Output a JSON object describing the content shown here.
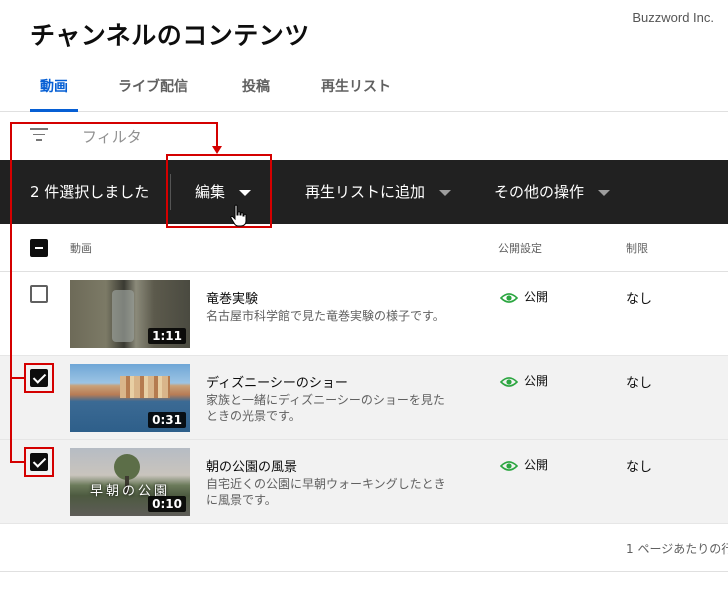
{
  "watermark": "Buzzword Inc.",
  "page_title": "チャンネルのコンテンツ",
  "tabs": [
    {
      "label": "動画",
      "active": true
    },
    {
      "label": "ライブ配信",
      "active": false
    },
    {
      "label": "投稿",
      "active": false
    },
    {
      "label": "再生リスト",
      "active": false
    }
  ],
  "filter": {
    "placeholder": "フィルタ",
    "icon": "filter-icon"
  },
  "action_bar": {
    "selected_text": "2 件選択しました",
    "edit_label": "編集",
    "add_playlist_label": "再生リストに追加",
    "more_actions_label": "その他の操作"
  },
  "table": {
    "headers": {
      "video": "動画",
      "visibility": "公開設定",
      "restrictions": "制限"
    },
    "rows": [
      {
        "title": "竜巻実験",
        "description": "名古屋市科学館で見た竜巻実験の様子です。",
        "duration": "1:11",
        "visibility": "公開",
        "restriction": "なし",
        "checked": false
      },
      {
        "title": "ディズニーシーのショー",
        "description": "家族と一緒にディズニーシーのショーを見たときの光景です。",
        "duration": "0:31",
        "visibility": "公開",
        "restriction": "なし",
        "checked": true
      },
      {
        "title": "朝の公園の風景",
        "description": "自宅近くの公園に早朝ウォーキングしたときに風景です。",
        "duration": "0:10",
        "visibility": "公開",
        "restriction": "なし",
        "checked": true,
        "thumb_caption": "早朝の公園"
      }
    ]
  },
  "footer": {
    "per_page_text": "1 ページあたりの行"
  },
  "colors": {
    "accent": "#065fd4",
    "action_bar": "#212121",
    "annotation": "#d40000",
    "public_icon": "#2ba640"
  }
}
